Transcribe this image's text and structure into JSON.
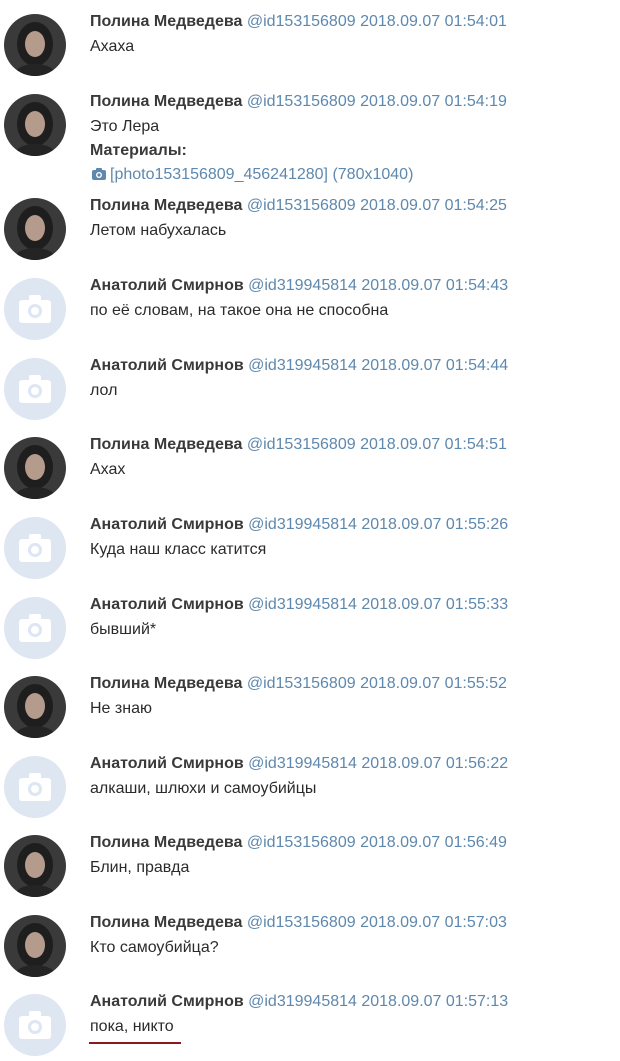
{
  "messages": [
    {
      "name": "Полина Медведева",
      "id": "@id153156809",
      "time": "2018.09.07 01:54:01",
      "text": "Ахаха",
      "avatar": "photo"
    },
    {
      "name": "Полина Медведева",
      "id": "@id153156809",
      "time": "2018.09.07 01:54:19",
      "text": "Это Лера",
      "avatar": "photo",
      "attachment": {
        "label": "Материалы:",
        "link": "[photo153156809_456241280]",
        "size": "(780x1040)",
        "icon": "camera-icon"
      }
    },
    {
      "name": "Полина Медведева",
      "id": "@id153156809",
      "time": "2018.09.07 01:54:25",
      "text": "Летом набухалась",
      "avatar": "photo"
    },
    {
      "name": "Анатолий Смирнов",
      "id": "@id319945814",
      "time": "2018.09.07 01:54:43",
      "text": "по её словам, на такое она не способна",
      "avatar": "camera-placeholder"
    },
    {
      "name": "Анатолий Смирнов",
      "id": "@id319945814",
      "time": "2018.09.07 01:54:44",
      "text": "лол",
      "avatar": "camera-placeholder"
    },
    {
      "name": "Полина Медведева",
      "id": "@id153156809",
      "time": "2018.09.07 01:54:51",
      "text": "Ахах",
      "avatar": "photo"
    },
    {
      "name": "Анатолий Смирнов",
      "id": "@id319945814",
      "time": "2018.09.07 01:55:26",
      "text": "Куда наш класс катится",
      "avatar": "camera-placeholder"
    },
    {
      "name": "Анатолий Смирнов",
      "id": "@id319945814",
      "time": "2018.09.07 01:55:33",
      "text": "бывший*",
      "avatar": "camera-placeholder"
    },
    {
      "name": "Полина Медведева",
      "id": "@id153156809",
      "time": "2018.09.07 01:55:52",
      "text": "Не знаю",
      "avatar": "photo"
    },
    {
      "name": "Анатолий Смирнов",
      "id": "@id319945814",
      "time": "2018.09.07 01:56:22",
      "text": "алкаши, шлюхи и самоубийцы",
      "avatar": "camera-placeholder"
    },
    {
      "name": "Полина Медведева",
      "id": "@id153156809",
      "time": "2018.09.07 01:56:49",
      "text": "Блин, правда",
      "avatar": "photo"
    },
    {
      "name": "Полина Медведева",
      "id": "@id153156809",
      "time": "2018.09.07 01:57:03",
      "text": "Кто самоубийца?",
      "avatar": "photo"
    },
    {
      "name": "Анатолий Смирнов",
      "id": "@id319945814",
      "time": "2018.09.07 01:57:13",
      "text": "пока, никто",
      "avatar": "camera-placeholder",
      "underlined": true
    }
  ],
  "colors": {
    "name": "#3a3a3a",
    "link": "#5e88ad",
    "text": "#2b2b2b",
    "placeholder_bg": "#dde6f1",
    "placeholder_icon": "#ffffff",
    "underline": "#8b1a1a"
  }
}
